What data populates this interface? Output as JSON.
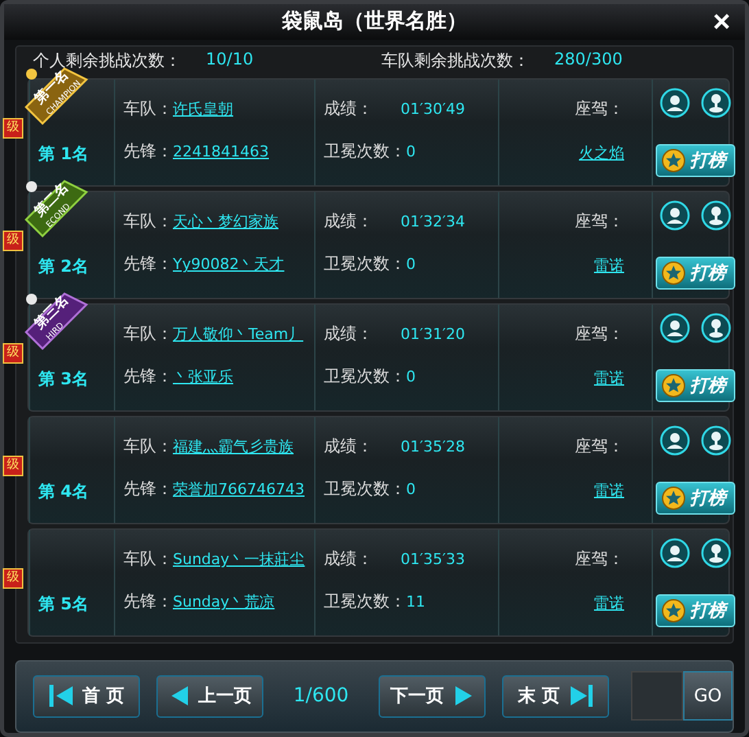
{
  "window": {
    "title": "袋鼠岛（世界名胜）",
    "close": "×"
  },
  "summary": {
    "personal_label": "个人剩余挑战次数：",
    "personal_value": "10/10",
    "team_label": "车队剩余挑战次数：",
    "team_value": "280/300"
  },
  "rows": [
    {
      "badge": "级",
      "ribbon": {
        "kind": "gold",
        "label": "第一名",
        "sub": "CHAMPION"
      },
      "rank": "第 1名",
      "team_label": "车队：",
      "team": "许氏皇朝",
      "vanguard_label": "先锋：",
      "vanguard": "2241841463",
      "result_label": "成绩：",
      "time": "01′30′49",
      "defends_label": "卫冕次数：",
      "defends": "0",
      "car_label": "座驾：",
      "car": "火之焰",
      "rank_button": "打榜"
    },
    {
      "badge": "级",
      "ribbon": {
        "kind": "green",
        "label": "第二名",
        "sub": "ECOND"
      },
      "rank": "第 2名",
      "team_label": "车队：",
      "team": "天心丶梦幻家族",
      "vanguard_label": "先锋：",
      "vanguard": "Yy90082丶天才",
      "result_label": "成绩：",
      "time": "01′32′34",
      "defends_label": "卫冕次数：",
      "defends": "0",
      "car_label": "座驾：",
      "car": "雷诺",
      "rank_button": "打榜"
    },
    {
      "badge": "级",
      "ribbon": {
        "kind": "purple",
        "label": "第三名",
        "sub": "HIRD"
      },
      "rank": "第 3名",
      "team_label": "车队：",
      "team": "万人敬仰丶Team丿",
      "vanguard_label": "先锋：",
      "vanguard": "丶张亚乐",
      "result_label": "成绩：",
      "time": "01′31′20",
      "defends_label": "卫冕次数：",
      "defends": "0",
      "car_label": "座驾：",
      "car": "雷诺",
      "rank_button": "打榜"
    },
    {
      "badge": "级",
      "rank": "第 4名",
      "team_label": "车队：",
      "team": "福建灬霸气彡贵族",
      "vanguard_label": "先锋：",
      "vanguard": "荣誉加766746743",
      "result_label": "成绩：",
      "time": "01′35′28",
      "defends_label": "卫冕次数：",
      "defends": "0",
      "car_label": "座驾：",
      "car": "雷诺",
      "rank_button": "打榜"
    },
    {
      "badge": "级",
      "rank": "第 5名",
      "team_label": "车队：",
      "team": "Sunday丶一抹莊尘",
      "vanguard_label": "先锋：",
      "vanguard": "Sunday丶荒凉",
      "result_label": "成绩：",
      "time": "01′35′33",
      "defends_label": "卫冕次数：",
      "defends": "11",
      "car_label": "座驾：",
      "car": "雷诺",
      "rank_button": "打榜"
    }
  ],
  "pager": {
    "first": "首 页",
    "prev": "上一页",
    "page": "1/600",
    "next": "下一页",
    "last": "末 页",
    "go": "GO"
  }
}
